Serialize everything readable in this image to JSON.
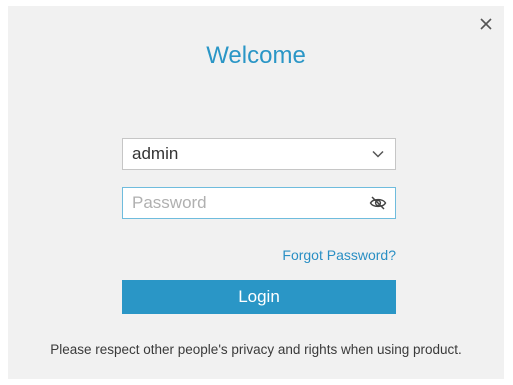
{
  "dialog": {
    "title": "Welcome",
    "close_icon": "close-icon"
  },
  "username": {
    "selected": "admin",
    "icon": "chevron-down-icon"
  },
  "password": {
    "value": "",
    "placeholder": "Password",
    "icon": "eye-slash-icon"
  },
  "links": {
    "forgot_password": "Forgot Password?"
  },
  "actions": {
    "login_label": "Login"
  },
  "footer": {
    "notice": "Please respect other people's privacy and rights when using product."
  },
  "colors": {
    "accent": "#2a96c6",
    "link": "#2a8fc4",
    "dialog_bg": "#f1f1f1",
    "focus_border": "#6fbcdd"
  }
}
